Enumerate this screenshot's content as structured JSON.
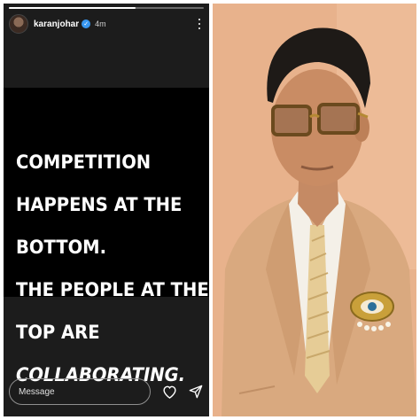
{
  "story": {
    "username": "karanjohar",
    "timestamp": "4m",
    "progress": 0.65,
    "quote_lines": [
      "COMPETITION",
      "HAPPENS AT THE",
      "BOTTOM.",
      "THE PEOPLE AT THE",
      "TOP ARE",
      "COLLABORATING."
    ],
    "message_placeholder": "Message",
    "icons": {
      "verified": "verified-badge-icon",
      "more": "more-options-icon",
      "like": "heart-icon",
      "send": "send-icon"
    }
  },
  "photo": {
    "subject": "portrait-photo",
    "colors": {
      "background": "#eab38e",
      "suit": "#dcae86",
      "shirt": "#f5f1ea",
      "tie": "#e8cf9a",
      "hair": "#1e1a17",
      "brooch": "#c9a03a"
    }
  }
}
